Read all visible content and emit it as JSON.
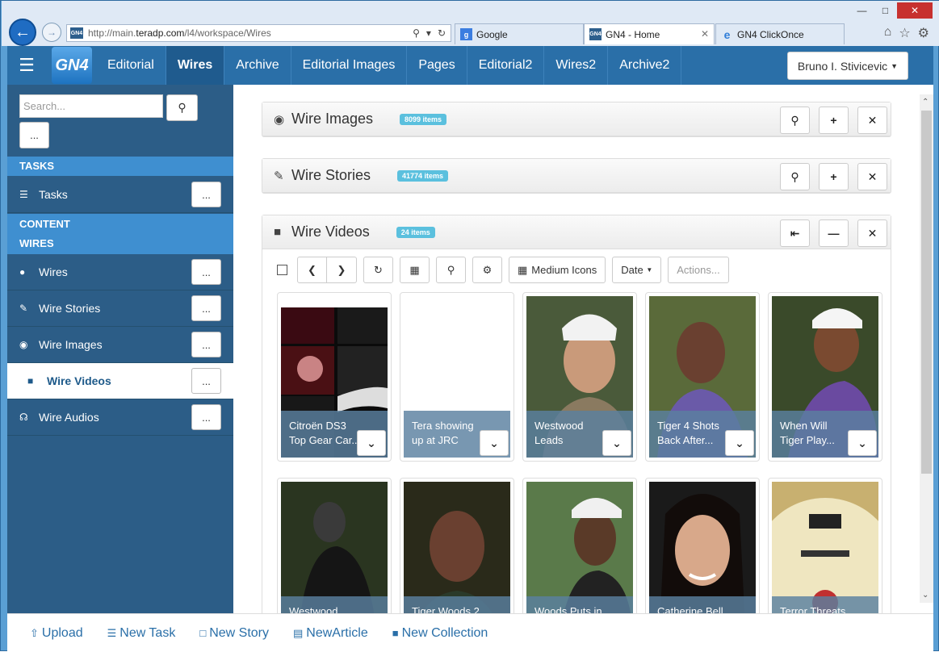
{
  "browser": {
    "url_prefix": "http://main.",
    "url_domain": "teradp.com",
    "url_path": "/l4/workspace/Wires",
    "tabs": [
      {
        "label": "Google"
      },
      {
        "label": "GN4 - Home"
      },
      {
        "label": "GN4 ClickOnce"
      }
    ],
    "back_icon": "arrow-left-icon",
    "forward_icon": "arrow-right-icon"
  },
  "header": {
    "logo": "GN4",
    "nav": [
      "Editorial",
      "Wires",
      "Archive",
      "Editorial Images",
      "Pages",
      "Editorial2",
      "Wires2",
      "Archive2"
    ],
    "active_nav": "Wires",
    "user": "Bruno I. Stivicevic"
  },
  "sidebar": {
    "search_placeholder": "Search...",
    "more_label": "...",
    "sections": {
      "tasks": "TASKS",
      "content": "CONTENT",
      "wires": "WIRES"
    },
    "items": [
      {
        "label": "Tasks",
        "icon": "list-icon"
      },
      {
        "label": "Wires",
        "icon": "globe-icon"
      },
      {
        "label": "Wire Stories",
        "icon": "pencil-icon"
      },
      {
        "label": "Wire Images",
        "icon": "camera-icon"
      },
      {
        "label": "Wire Videos",
        "icon": "video-camera-icon"
      },
      {
        "label": "Wire Audios",
        "icon": "headphones-icon"
      }
    ]
  },
  "panels": [
    {
      "title": "Wire Images",
      "badge": "8099 items"
    },
    {
      "title": "Wire Stories",
      "badge": "41774 items"
    },
    {
      "title": "Wire Videos",
      "badge": "24 items"
    }
  ],
  "toolbar": {
    "view_label": "Medium Icons",
    "sort_label": "Date",
    "actions_label": "Actions..."
  },
  "cards_row1": [
    {
      "caption": "Citroën DS3 Top Gear Car..."
    },
    {
      "caption": "Tera showing up at JRC"
    },
    {
      "caption": "Westwood Leads Masters..."
    },
    {
      "caption": "Tiger 4 Shots Back After..."
    },
    {
      "caption": "When Will Tiger Play..."
    }
  ],
  "cards_row2": [
    {
      "caption": "Westwood"
    },
    {
      "caption": "Tiger Woods 2"
    },
    {
      "caption": "Woods Puts in"
    },
    {
      "caption": "Catherine Bell on"
    },
    {
      "caption": "Terror Threats"
    }
  ],
  "bottom": [
    "Upload",
    "New Task",
    "New Story",
    "NewArticle",
    "New Collection"
  ],
  "colors": {
    "nav_bg": "#2a6fa8",
    "sidebar_bg": "#2c5d87",
    "section_bg": "#3f8fd0",
    "badge": "#5bc0de"
  }
}
